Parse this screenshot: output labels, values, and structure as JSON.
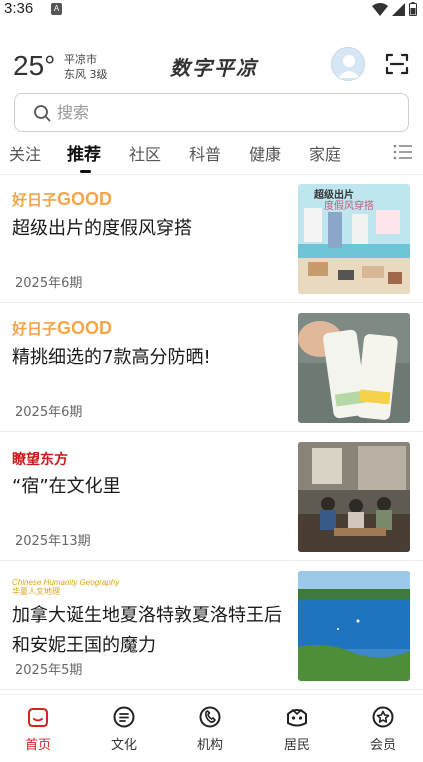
{
  "status_bar": {
    "time": "3:36",
    "notification_glyph": "A"
  },
  "header": {
    "temperature": "25°",
    "city": "平凉市",
    "wind": "东风  3级",
    "brand": "数字平凉"
  },
  "search": {
    "placeholder": "搜索"
  },
  "tabs": [
    {
      "label": "关注"
    },
    {
      "label": "推荐",
      "active": true
    },
    {
      "label": "社区"
    },
    {
      "label": "科普"
    },
    {
      "label": "健康"
    },
    {
      "label": "家庭"
    }
  ],
  "articles": [
    {
      "magazine": {
        "prefix": "好日子",
        "suffix": "GOOD"
      },
      "title": "超级出片的度假风穿搭",
      "issue": "2025年6期",
      "thumb_text": [
        "超级出片",
        "度假风穿搭"
      ]
    },
    {
      "magazine": {
        "prefix": "好日子",
        "suffix": "GOOD"
      },
      "title": "精挑细选的7款高分防晒!",
      "issue": "2025年6期"
    },
    {
      "magazine": {
        "name": "瞭望东方"
      },
      "title": "“宿”在文化里",
      "issue": "2025年13期"
    },
    {
      "magazine": {
        "line1": "Chinese Humanity Geography",
        "line2": "华夏人文地理"
      },
      "title": "加拿大诞生地夏洛特敦夏洛特王后和安妮王国的魔力",
      "issue": "2025年5期"
    }
  ],
  "bottom_nav": [
    {
      "label": "首页",
      "icon": "home-icon",
      "active": true
    },
    {
      "label": "文化",
      "icon": "culture-icon"
    },
    {
      "label": "机构",
      "icon": "institution-icon"
    },
    {
      "label": "居民",
      "icon": "resident-icon"
    },
    {
      "label": "会员",
      "icon": "member-icon"
    }
  ],
  "colors": {
    "accent": "#d2251f",
    "magazine_good": "#f4a54a",
    "liaowang": "#cc1a1a"
  }
}
